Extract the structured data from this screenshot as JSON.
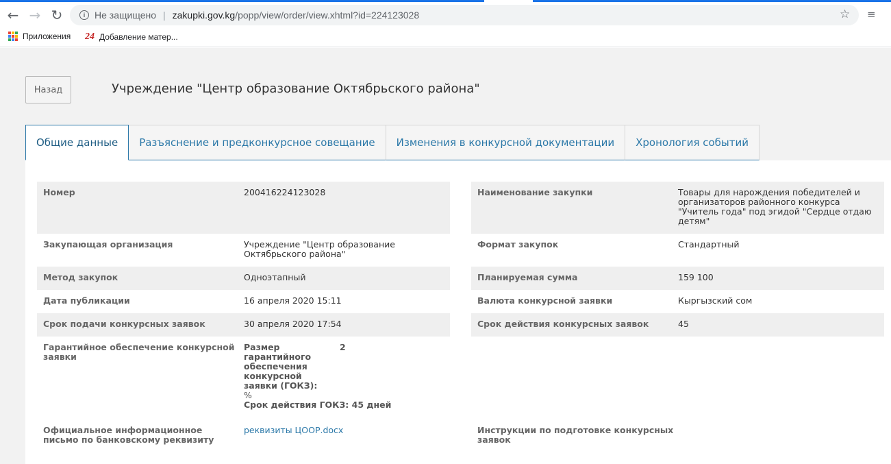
{
  "browser": {
    "security_label": "Не защищено",
    "url_host": "zakupki.gov.kg",
    "url_path": "/popp/view/order/view.xhtml?id=224123028",
    "bookmarks": [
      {
        "label": "Приложения",
        "icon": "apps-grid-icon"
      },
      {
        "label": "Добавление матер...",
        "icon": "site-24-icon"
      }
    ]
  },
  "header": {
    "back_label": "Назад",
    "title": "Учреждение \"Центр образование Октябрьского района\""
  },
  "tabs": [
    {
      "label": "Общие данные",
      "active": true
    },
    {
      "label": "Разъяснение и предконкурсное совещание",
      "active": false
    },
    {
      "label": "Изменения в конкурсной документации",
      "active": false
    },
    {
      "label": "Хронология событий",
      "active": false
    }
  ],
  "left_rows": [
    {
      "label": "Номер",
      "value": "200416224123028"
    },
    {
      "label": "Закупающая организация",
      "value": "Учреждение \"Центр образование Октябрьского района\""
    },
    {
      "label": "Метод закупок",
      "value": "Одноэтапный"
    },
    {
      "label": "Дата публикации",
      "value": "16 апреля 2020 15:11"
    },
    {
      "label": "Срок подачи конкурсных заявок",
      "value": "30 апреля 2020 17:54"
    }
  ],
  "guarantee": {
    "label": "Гарантийное обеспечение конкурсной заявки",
    "size_label": "Размер гарантийного обеспечения конкурсной заявки (ГОКЗ):",
    "size_value": "2",
    "unit": "%",
    "term": "Срок действия ГОКЗ: 45 дней"
  },
  "letter": {
    "label": "Официальное информационное письмо по банковскому реквизиту",
    "file": "реквизиты ЦООР.docx"
  },
  "right_rows": [
    {
      "label": "Наименование закупки",
      "value": "Товары для нарождения победителей и организаторов районного конкурса \"Учитель года\" под эгидой \"Сердце отдаю детям\""
    },
    {
      "label": "Формат закупок",
      "value": "Стандартный"
    },
    {
      "label": "Планируемая сумма",
      "value": "159 100"
    },
    {
      "label": "Валюта конкурсной заявки",
      "value": "Кыргызский сом"
    },
    {
      "label": "Срок действия конкурсных заявок",
      "value": "45"
    }
  ],
  "instructions_label": "Инструкции по подготовке конкурсных заявок",
  "colors": {
    "accent": "#2b78a8",
    "page_bg": "#f2f2f2",
    "row_shade": "#efefef"
  }
}
